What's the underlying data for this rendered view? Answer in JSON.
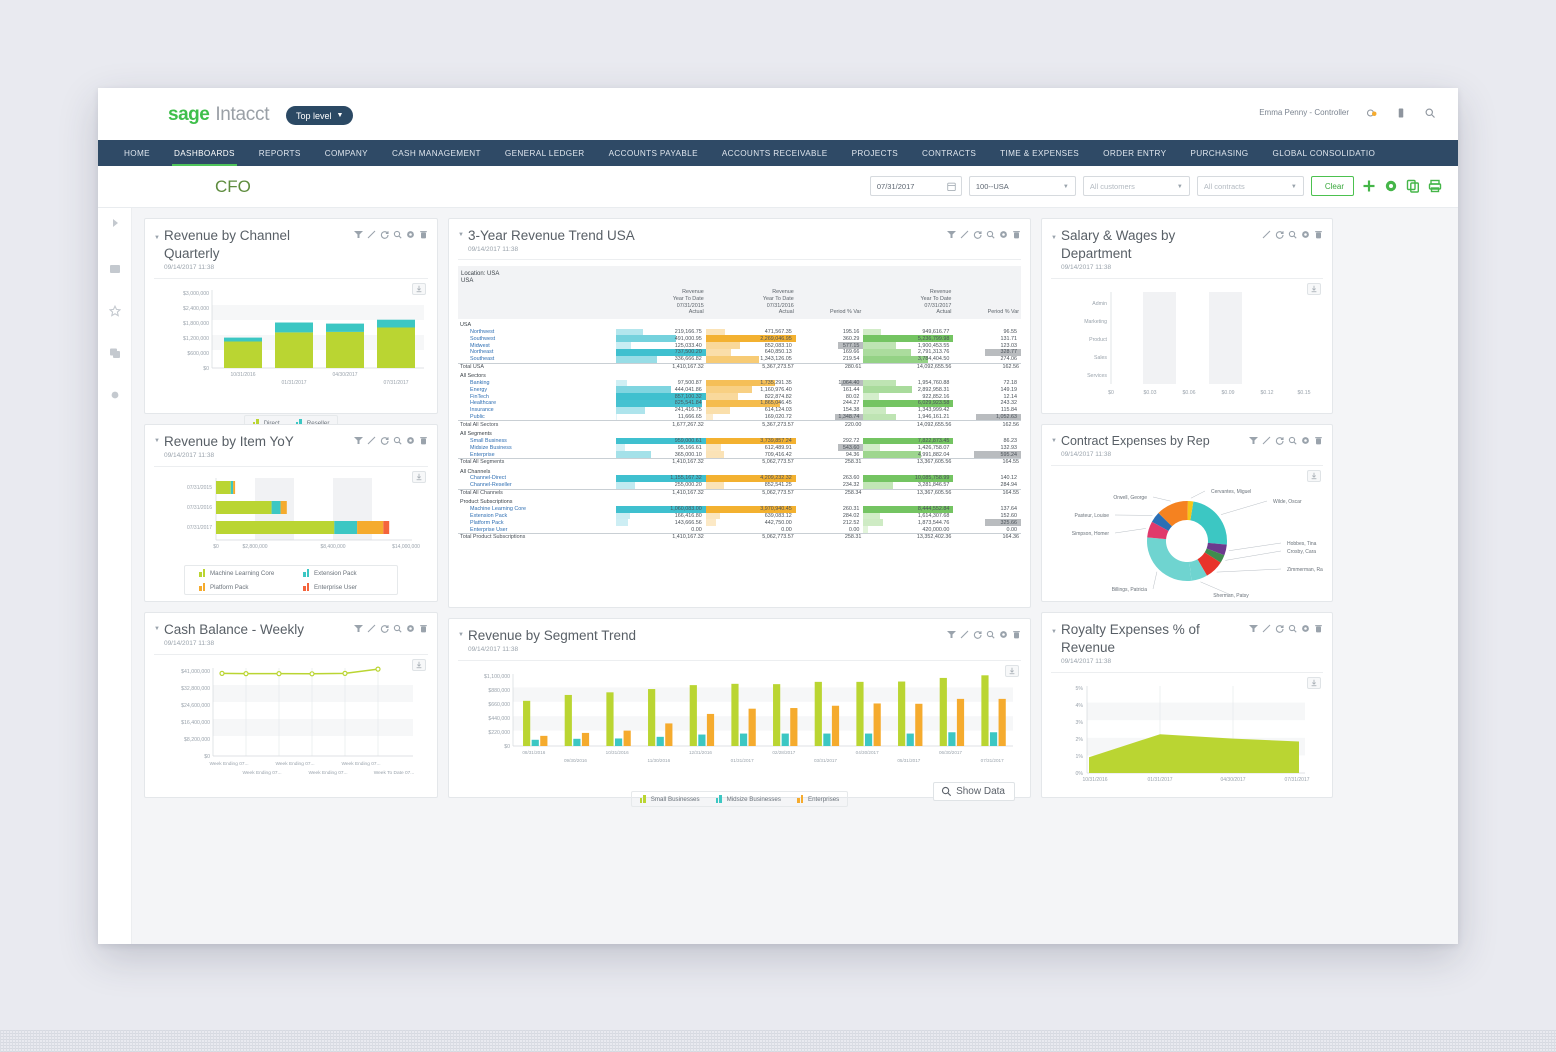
{
  "app": {
    "brand_sage": "sage",
    "brand_intacct": "Intacct",
    "top_level_label": "Top level",
    "user": "Emma Penny - Controller"
  },
  "nav": {
    "items": [
      {
        "label": "HOME",
        "active": false
      },
      {
        "label": "DASHBOARDS",
        "active": true
      },
      {
        "label": "REPORTS",
        "active": false
      },
      {
        "label": "COMPANY",
        "active": false
      },
      {
        "label": "CASH MANAGEMENT",
        "active": false
      },
      {
        "label": "GENERAL LEDGER",
        "active": false
      },
      {
        "label": "ACCOUNTS PAYABLE",
        "active": false
      },
      {
        "label": "ACCOUNTS RECEIVABLE",
        "active": false
      },
      {
        "label": "PROJECTS",
        "active": false
      },
      {
        "label": "CONTRACTS",
        "active": false
      },
      {
        "label": "TIME & EXPENSES",
        "active": false
      },
      {
        "label": "ORDER ENTRY",
        "active": false
      },
      {
        "label": "PURCHASING",
        "active": false
      },
      {
        "label": "GLOBAL CONSOLIDATIO",
        "active": false
      }
    ]
  },
  "dashboard": {
    "title": "CFO",
    "filters": {
      "date_value": "07/31/2017",
      "location_value": "100--USA",
      "customers_placeholder": "All customers",
      "contracts_placeholder": "All contracts",
      "clear_label": "Clear"
    }
  },
  "widgets": {
    "revenue_by_channel": {
      "title": "Revenue by Channel Quarterly",
      "timestamp": "09/14/2017 11:38"
    },
    "revenue_by_item": {
      "title": "Revenue by Item YoY",
      "timestamp": "09/14/2017 11:38"
    },
    "cash_balance": {
      "title": "Cash Balance - Weekly",
      "timestamp": "09/14/2017 11:38"
    },
    "revenue_trend": {
      "title": "3-Year Revenue Trend USA",
      "timestamp": "09/14/2017 11:38"
    },
    "segment_trend": {
      "title": "Revenue by Segment Trend",
      "timestamp": "09/14/2017 11:38",
      "show_data_label": "Show Data"
    },
    "salary_wages": {
      "title": "Salary & Wages by Department",
      "timestamp": "09/14/2017 11:38"
    },
    "contract_expenses": {
      "title": "Contract Expenses by Rep",
      "timestamp": "09/14/2017 11:38"
    },
    "royalty_expenses": {
      "title": "Royalty Expenses % of Revenue",
      "timestamp": "09/14/2017 11:38"
    }
  },
  "chart_data": [
    {
      "id": "revenue_by_channel",
      "type": "bar",
      "title": "Revenue by Channel Quarterly",
      "stacked": true,
      "categories": [
        "10/31/2016",
        "01/31/2017",
        "04/30/2017",
        "07/31/2017"
      ],
      "series": [
        {
          "name": "Direct",
          "color": "#bad532",
          "values": [
            1020000,
            1370000,
            1390000,
            1560000
          ]
        },
        {
          "name": "Reseller",
          "color": "#3cc7c3",
          "values": [
            150000,
            380000,
            320000,
            300000
          ]
        }
      ],
      "ylabel": "",
      "xlabel": "",
      "ylim": [
        0,
        3000000
      ],
      "yticks": [
        "$0",
        "$600,000",
        "$1,200,000",
        "$1,800,000",
        "$2,400,000",
        "$3,000,000"
      ],
      "legend_position": "bottom",
      "grid": true
    },
    {
      "id": "revenue_by_item",
      "type": "bar",
      "title": "Revenue by Item YoY",
      "orientation": "horizontal",
      "stacked": true,
      "categories": [
        "07/31/2015",
        "07/31/2016",
        "07/31/2017"
      ],
      "series": [
        {
          "name": "Machine Learning Core",
          "color": "#bad532",
          "values": [
            1060000,
            3970000,
            8450000
          ]
        },
        {
          "name": "Extension Pack",
          "color": "#3cc7c3",
          "values": [
            166000,
            640000,
            1630000
          ]
        },
        {
          "name": "Platform Pack",
          "color": "#f5ab2e",
          "values": [
            144000,
            443000,
            1870000
          ]
        },
        {
          "name": "Enterprise User",
          "color": "#f4643c",
          "values": [
            0,
            0,
            420000
          ]
        }
      ],
      "xlim": [
        0,
        14000000
      ],
      "xticks": [
        "$0",
        "$2,800,000",
        "$8,400,000",
        "$14,000,000"
      ],
      "legend_position": "bottom",
      "grid": true
    },
    {
      "id": "cash_balance",
      "type": "line",
      "title": "Cash Balance - Weekly",
      "categories": [
        "Week Ending 07...",
        "Week Ending 07...",
        "Week Ending 07...",
        "Week Ending 07...",
        "Week Ending 07...",
        "Week To Date 07..."
      ],
      "series": [
        {
          "name": "Cash Balance",
          "color": "#bad532",
          "values": [
            38500000,
            38400000,
            38400000,
            38300000,
            38500000,
            40500000
          ]
        }
      ],
      "ylim": [
        0,
        41000000
      ],
      "yticks": [
        "$0",
        "$8,200,000",
        "$16,400,000",
        "$24,600,000",
        "$32,800,000",
        "$41,000,000"
      ],
      "grid": true,
      "legend_position": "none"
    },
    {
      "id": "segment_trend",
      "type": "bar",
      "title": "Revenue by Segment Trend",
      "categories": [
        "08/31/2016",
        "09/30/2016",
        "10/31/2016",
        "11/30/2016",
        "12/31/2016",
        "01/31/2017",
        "02/28/2017",
        "03/31/2017",
        "04/30/2017",
        "05/31/2017",
        "06/30/2017",
        "07/31/2017"
      ],
      "series": [
        {
          "name": "Small Businesses",
          "color": "#bad532",
          "values": [
            690000,
            780000,
            820000,
            870000,
            930000,
            950000,
            945000,
            980000,
            980000,
            985000,
            1040000,
            1080000
          ]
        },
        {
          "name": "Midsize Businesses",
          "color": "#3cc7c3",
          "values": [
            95000,
            110000,
            115000,
            140000,
            175000,
            190000,
            190000,
            190000,
            190000,
            190000,
            210000,
            210000
          ]
        },
        {
          "name": "Enterprises",
          "color": "#f5ab2e",
          "values": [
            155000,
            200000,
            235000,
            345000,
            490000,
            570000,
            580000,
            615000,
            650000,
            645000,
            720000,
            720000
          ]
        }
      ],
      "ylim": [
        0,
        1100000
      ],
      "yticks": [
        "$0",
        "$220,000",
        "$440,000",
        "$660,000",
        "$880,000",
        "$1,100,000"
      ],
      "legend_position": "bottom",
      "grid": true
    },
    {
      "id": "salary_wages",
      "type": "bar",
      "title": "Salary & Wages by Department",
      "orientation": "horizontal",
      "categories": [
        "Admin",
        "Marketing",
        "Product",
        "Sales",
        "Services"
      ],
      "series": [
        {
          "name": "Salary & Wages",
          "color": "#bad532",
          "values": [
            0,
            0,
            0,
            0,
            0
          ]
        }
      ],
      "xlim": [
        0,
        0.15
      ],
      "xticks": [
        "$0",
        "$0.03",
        "$0.06",
        "$0.09",
        "$0.12",
        "$0.15"
      ],
      "grid": true,
      "legend_position": "none"
    },
    {
      "id": "contract_expenses",
      "type": "pie",
      "title": "Contract Expenses by Rep",
      "donut": true,
      "labels": [
        "Wilde, Oscar",
        "Hobbes, Tina",
        "Crosby, Cara",
        "Zimmerman, Rachel",
        "Sherman, Patsy",
        "Billings, Patricia",
        "Simpson, Homer",
        "Pasteur, Louise",
        "Orwell, George",
        "Cervantes, Miguel"
      ],
      "values": [
        22,
        4,
        3,
        7,
        6,
        26,
        6,
        4,
        12,
        2
      ],
      "colors": [
        "#3cc7c3",
        "#6c3a8e",
        "#3f8c4e",
        "#e8342a",
        "#6fd4d0",
        "#6fd4d0",
        "#e0396b",
        "#2a6fb5",
        "#f58220",
        "#f5c518"
      ],
      "legend_position": "callout"
    },
    {
      "id": "royalty_expenses",
      "type": "area",
      "title": "Royalty Expenses % of Revenue",
      "categories": [
        "10/31/2016",
        "01/31/2017",
        "04/30/2017",
        "07/31/2017"
      ],
      "series": [
        {
          "name": "Royalty %",
          "color": "#bad532",
          "values": [
            0.9,
            2.2,
            1.95,
            1.8
          ]
        }
      ],
      "ylim": [
        0,
        5
      ],
      "yticks": [
        "0%",
        "1%",
        "2%",
        "3%",
        "4%",
        "5%"
      ],
      "grid": true,
      "legend_position": "none"
    }
  ],
  "report": {
    "location_line1": "Location: USA",
    "location_line2": "USA",
    "column_groups": [
      {
        "lines": [
          "Revenue",
          "Year To Date",
          "07/31/2015",
          "Actual"
        ]
      },
      {
        "lines": [
          "Revenue",
          "Year To Date",
          "07/31/2016",
          "Actual"
        ]
      },
      {
        "lines": [
          "",
          "",
          "",
          "Period % Var"
        ]
      },
      {
        "lines": [
          "Revenue",
          "Year To Date",
          "07/31/2017",
          "Actual"
        ]
      },
      {
        "lines": [
          "",
          "",
          "",
          "Period % Var"
        ]
      }
    ],
    "sections": [
      {
        "name": "USA",
        "rows": [
          {
            "label": "Northwest",
            "c1": "219,166.75",
            "c1f": 0.3,
            "c2": "471,567.35",
            "c2f": 0.21,
            "v1": "195.16",
            "v1f": 0.1,
            "c3": "949,616.77",
            "c3f": 0.2,
            "v2": "96.55",
            "v2f": 0.08
          },
          {
            "label": "Southwest",
            "c1": "491,000.95",
            "c1f": 0.67,
            "c2": "2,269,046.95",
            "c2f": 1.0,
            "v1": "360.29",
            "v1f": 0.22,
            "c3": "5,236,799.98",
            "c3f": 1.0,
            "v2": "131.71",
            "v2f": 0.12
          },
          {
            "label": "Midwest",
            "c1": "125,033.40",
            "c1f": 0.17,
            "c2": "852,083.10",
            "c2f": 0.38,
            "v1": "577.15",
            "v1f": 0.52,
            "c3": "1,900,453.55",
            "c3f": 0.36,
            "v2": "123.03",
            "v2f": 0.11
          },
          {
            "label": "Northeast",
            "c1": "737,500.20",
            "c1f": 1.0,
            "c2": "640,850.13",
            "c2f": 0.28,
            "v1": "169.66",
            "v1f": 0.09,
            "c3": "2,791,313.76",
            "c3f": 0.53,
            "v2": "328.77",
            "v2f": 0.75
          },
          {
            "label": "Southeast",
            "c1": "336,666.82",
            "c1f": 0.46,
            "c2": "1,343,126.05",
            "c2f": 0.59,
            "v1": "219.54",
            "v1f": 0.13,
            "c3": "3,784,404.50",
            "c3f": 0.72,
            "v2": "274.06",
            "v2f": 0.24
          }
        ],
        "total": {
          "label": "Total USA",
          "c1": "1,410,167.32",
          "c2": "5,367,273.57",
          "v1": "280.61",
          "c3": "14,092,655.56",
          "v2": "162.56"
        }
      },
      {
        "name": "All Sectors",
        "rows": [
          {
            "label": "Banking",
            "c1": "97,500.87",
            "c1f": 0.13,
            "c2": "1,735,291.35",
            "c2f": 0.77,
            "v1": "1,064.40",
            "v1f": 0.46,
            "c3": "1,954,760.88",
            "c3f": 0.36,
            "v2": "72.18",
            "v2f": 0.06
          },
          {
            "label": "Energy",
            "c1": "444,041.86",
            "c1f": 0.61,
            "c2": "1,160,976.40",
            "c2f": 0.51,
            "v1": "161.44",
            "v1f": 0.08,
            "c3": "2,892,958.31",
            "c3f": 0.54,
            "v2": "149.19",
            "v2f": 0.13
          },
          {
            "label": "FinTech",
            "c1": "857,100.32",
            "c1f": 1.0,
            "c2": "822,874.82",
            "c2f": 0.36,
            "v1": "80.02",
            "v1f": 0.05,
            "c3": "922,852.16",
            "c3f": 0.17,
            "v2": "12.14",
            "v2f": 0.02
          },
          {
            "label": "Healthcare",
            "c1": "825,541.84",
            "c1f": 0.96,
            "c2": "1,865,046.45",
            "c2f": 0.83,
            "v1": "244.27",
            "v1f": 0.12,
            "c3": "6,029,923.58",
            "c3f": 1.0,
            "v2": "243.32",
            "v2f": 0.21
          },
          {
            "label": "Insurance",
            "c1": "241,416.75",
            "c1f": 0.33,
            "c2": "614,124.03",
            "c2f": 0.27,
            "v1": "154.38",
            "v1f": 0.08,
            "c3": "1,343,999.42",
            "c3f": 0.25,
            "v2": "115.84",
            "v2f": 0.1
          },
          {
            "label": "Public",
            "c1": "11,666.65",
            "c1f": 0.02,
            "c2": "169,020.72",
            "c2f": 0.08,
            "v1": "1,348.74",
            "v1f": 0.58,
            "c3": "1,946,161.21",
            "c3f": 0.36,
            "v2": "1,052.63",
            "v2f": 0.92
          }
        ],
        "total": {
          "label": "Total All Sectors",
          "c1": "1,677,267.32",
          "c2": "5,367,273.57",
          "v1": "220.00",
          "c3": "14,092,655.56",
          "v2": "162.56"
        }
      },
      {
        "name": "All Segments",
        "rows": [
          {
            "label": "Small Business",
            "c1": "959,000.61",
            "c1f": 1.0,
            "c2": "3,739,857.24",
            "c2f": 1.0,
            "v1": "292.72",
            "v1f": 0.18,
            "c3": "7,822,873.45",
            "c3f": 1.0,
            "v2": "86.23",
            "v2f": 0.08
          },
          {
            "label": "Midsize Business",
            "c1": "95,166.61",
            "c1f": 0.1,
            "c2": "612,489.91",
            "c2f": 0.17,
            "v1": "543.60",
            "v1f": 0.52,
            "c3": "1,426,758.07",
            "c3f": 0.19,
            "v2": "132.93",
            "v2f": 0.12
          },
          {
            "label": "Enterprise",
            "c1": "365,000.10",
            "c1f": 0.39,
            "c2": "709,416.42",
            "c2f": 0.2,
            "v1": "94.36",
            "v1f": 0.05,
            "c3": "4,991,882.04",
            "c3f": 0.64,
            "v2": "595.24",
            "v2f": 0.96
          }
        ],
        "total": {
          "label": "Total All Segments",
          "c1": "1,410,167.32",
          "c2": "5,062,773.57",
          "v1": "258.31",
          "c3": "13,367,605.56",
          "v2": "164.55"
        }
      },
      {
        "name": "All Channels",
        "rows": [
          {
            "label": "Channel-Direct",
            "c1": "1,155,167.32",
            "c1f": 1.0,
            "c2": "4,209,232.32",
            "c2f": 1.0,
            "v1": "263.60",
            "v1f": 0.17,
            "c3": "10,085,758.99",
            "c3f": 1.0,
            "v2": "140.12",
            "v2f": 0.12
          },
          {
            "label": "Channel-Reseller",
            "c1": "255,000.20",
            "c1f": 0.22,
            "c2": "852,541.25",
            "c2f": 0.2,
            "v1": "234.32",
            "v1f": 0.15,
            "c3": "3,281,846.57",
            "c3f": 0.33,
            "v2": "284.94",
            "v2f": 0.25
          }
        ],
        "total": {
          "label": "Total All Channels",
          "c1": "1,410,167.32",
          "c2": "5,062,773.57",
          "v1": "258.34",
          "c3": "13,367,605.56",
          "v2": "164.55"
        }
      },
      {
        "name": "Product Subscriptions",
        "rows": [
          {
            "label": "Machine Learning Core",
            "c1": "1,060,083.00",
            "c1f": 1.0,
            "c2": "3,970,940.45",
            "c2f": 1.0,
            "v1": "260.31",
            "v1f": 0.17,
            "c3": "8,444,552.84",
            "c3f": 1.0,
            "v2": "137.64",
            "v2f": 0.12
          },
          {
            "label": "Extension Pack",
            "c1": "166,416.80",
            "c1f": 0.16,
            "c2": "639,083.12",
            "c2f": 0.16,
            "v1": "284.02",
            "v1f": 0.18,
            "c3": "1,614,307.68",
            "c3f": 0.19,
            "v2": "152.60",
            "v2f": 0.13
          },
          {
            "label": "Platform Pack",
            "c1": "143,666.56",
            "c1f": 0.14,
            "c2": "442,750.00",
            "c2f": 0.11,
            "v1": "212.52",
            "v1f": 0.14,
            "c3": "1,873,544.76",
            "c3f": 0.22,
            "v2": "325.66",
            "v2f": 0.74
          },
          {
            "label": "Enterprise User",
            "c1": "0.00",
            "c1f": 0.0,
            "c2": "0.00",
            "c2f": 0.0,
            "v1": "0.00",
            "v1f": 0.0,
            "c3": "420,000.00",
            "c3f": 0.05,
            "v2": "0.00",
            "v2f": 0.0
          }
        ],
        "total": {
          "label": "Total Product Subscriptions",
          "c1": "1,410,167.32",
          "c2": "5,062,773.57",
          "v1": "258.31",
          "c3": "13,352,402.36",
          "v2": "164.36"
        }
      }
    ]
  },
  "colors": {
    "green": "#bad532",
    "teal": "#3cc7c3",
    "orange": "#f5ab2e",
    "red_orange": "#f4643c",
    "nav_blue": "#2f4a66",
    "accent_green": "#45b649"
  }
}
